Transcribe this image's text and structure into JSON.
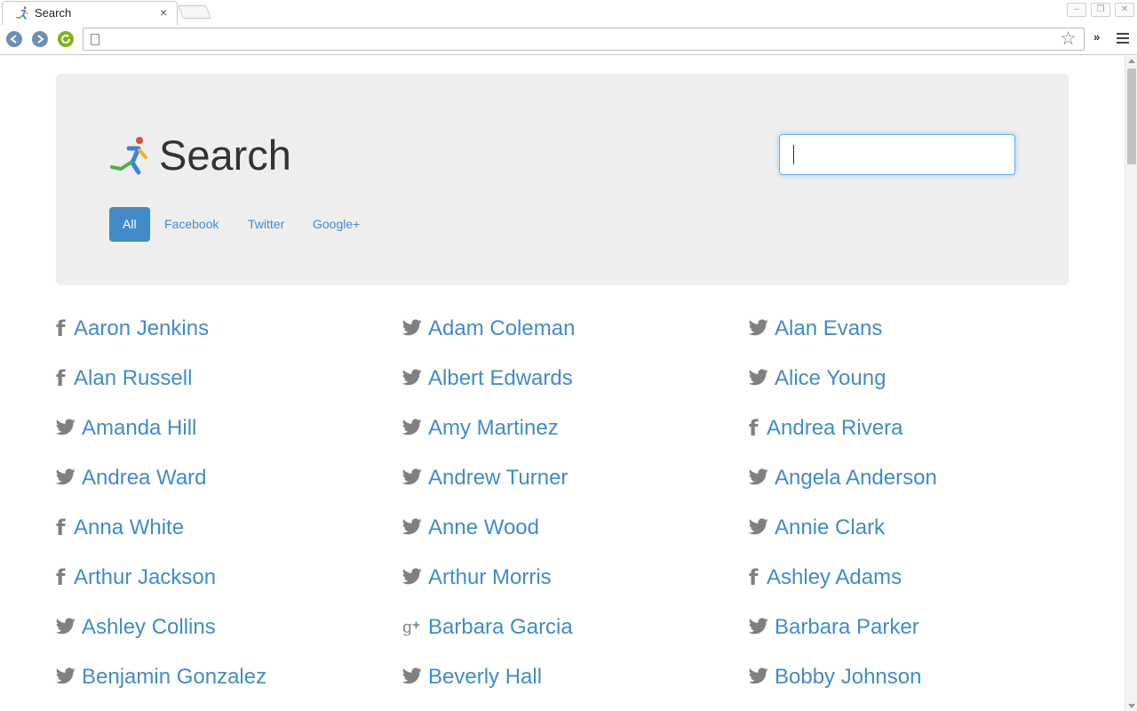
{
  "browser": {
    "tab_title": "Search",
    "tab_close": "×",
    "url": "",
    "extensions_chevron": "»"
  },
  "header": {
    "title": "Search",
    "search": {
      "value": "",
      "placeholder": ""
    }
  },
  "filters": [
    {
      "label": "All",
      "active": true
    },
    {
      "label": "Facebook",
      "active": false
    },
    {
      "label": "Twitter",
      "active": false
    },
    {
      "label": "Google+",
      "active": false
    }
  ],
  "colors": {
    "accent": "#428bca",
    "jumbotron_bg": "#eeeeee",
    "icon_gray": "#808080"
  },
  "results": [
    {
      "name": "Aaron Jenkins",
      "network": "facebook"
    },
    {
      "name": "Adam Coleman",
      "network": "twitter"
    },
    {
      "name": "Alan Evans",
      "network": "twitter"
    },
    {
      "name": "Alan Russell",
      "network": "facebook"
    },
    {
      "name": "Albert Edwards",
      "network": "twitter"
    },
    {
      "name": "Alice Young",
      "network": "twitter"
    },
    {
      "name": "Amanda Hill",
      "network": "twitter"
    },
    {
      "name": "Amy Martinez",
      "network": "twitter"
    },
    {
      "name": "Andrea Rivera",
      "network": "facebook"
    },
    {
      "name": "Andrea Ward",
      "network": "twitter"
    },
    {
      "name": "Andrew Turner",
      "network": "twitter"
    },
    {
      "name": "Angela Anderson",
      "network": "twitter"
    },
    {
      "name": "Anna White",
      "network": "facebook"
    },
    {
      "name": "Anne Wood",
      "network": "twitter"
    },
    {
      "name": "Annie Clark",
      "network": "twitter"
    },
    {
      "name": "Arthur Jackson",
      "network": "facebook"
    },
    {
      "name": "Arthur Morris",
      "network": "twitter"
    },
    {
      "name": "Ashley Adams",
      "network": "facebook"
    },
    {
      "name": "Ashley Collins",
      "network": "twitter"
    },
    {
      "name": "Barbara Garcia",
      "network": "googleplus"
    },
    {
      "name": "Barbara Parker",
      "network": "twitter"
    },
    {
      "name": "Benjamin Gonzalez",
      "network": "twitter"
    },
    {
      "name": "Beverly Hall",
      "network": "twitter"
    },
    {
      "name": "Bobby Johnson",
      "network": "twitter"
    }
  ]
}
